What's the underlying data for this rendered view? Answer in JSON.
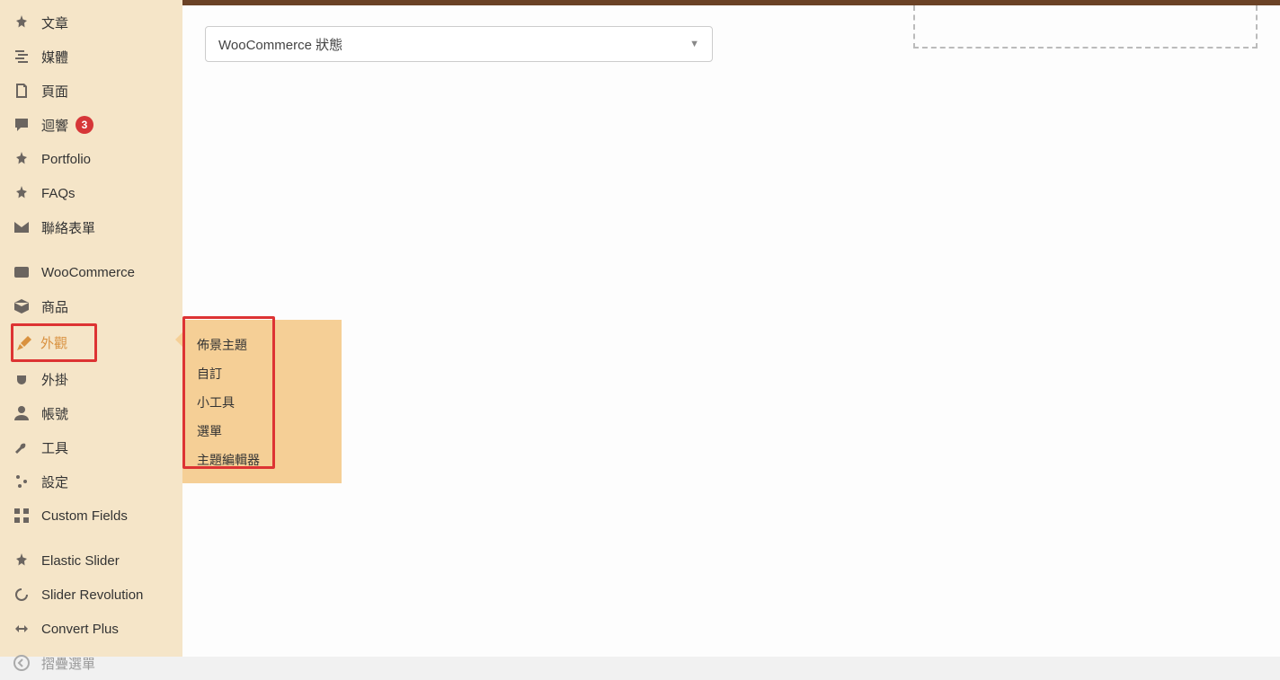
{
  "topbar": {},
  "select": {
    "label": "WooCommerce 狀態"
  },
  "sidebar": {
    "items": [
      {
        "label": "文章",
        "icon": "pin"
      },
      {
        "label": "媒體",
        "icon": "media"
      },
      {
        "label": "頁面",
        "icon": "page"
      },
      {
        "label": "迴響",
        "icon": "comment",
        "badge": "3"
      },
      {
        "label": "Portfolio",
        "icon": "pin"
      },
      {
        "label": "FAQs",
        "icon": "pin"
      },
      {
        "label": "聯絡表單",
        "icon": "mail"
      },
      {
        "label": "WooCommerce",
        "icon": "woo",
        "sep": true
      },
      {
        "label": "商品",
        "icon": "box"
      },
      {
        "label": "外觀",
        "icon": "brush",
        "highlight": true,
        "sep": true
      },
      {
        "label": "外掛",
        "icon": "plug"
      },
      {
        "label": "帳號",
        "icon": "user"
      },
      {
        "label": "工具",
        "icon": "wrench"
      },
      {
        "label": "設定",
        "icon": "sliders"
      },
      {
        "label": "Custom Fields",
        "icon": "grid"
      },
      {
        "label": "Elastic Slider",
        "icon": "pin",
        "sep": true
      },
      {
        "label": "Slider Revolution",
        "icon": "refresh"
      },
      {
        "label": "Convert Plus",
        "icon": "convert"
      },
      {
        "label": "摺疊選單",
        "icon": "collapse",
        "faded": true
      }
    ]
  },
  "flyout": {
    "items": [
      {
        "label": "佈景主題"
      },
      {
        "label": "自訂"
      },
      {
        "label": "小工具"
      },
      {
        "label": "選單"
      },
      {
        "label": "主題編輯器"
      }
    ]
  },
  "footer": {
    "left": "",
    "right": ""
  }
}
